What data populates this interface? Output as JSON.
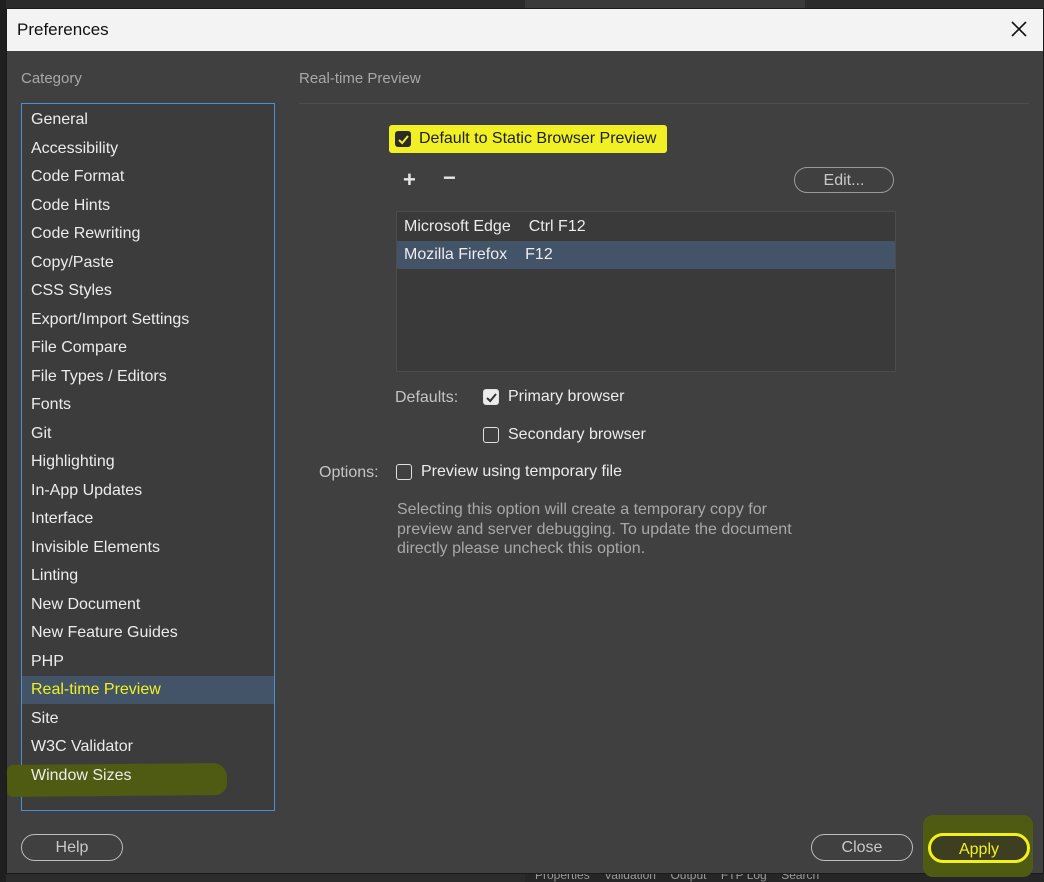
{
  "dialog": {
    "title": "Preferences"
  },
  "category": {
    "label": "Category",
    "items": [
      "General",
      "Accessibility",
      "Code Format",
      "Code Hints",
      "Code Rewriting",
      "Copy/Paste",
      "CSS Styles",
      "Export/Import Settings",
      "File Compare",
      "File Types / Editors",
      "Fonts",
      "Git",
      "Highlighting",
      "In-App Updates",
      "Interface",
      "Invisible Elements",
      "Linting",
      "New Document",
      "New Feature Guides",
      "PHP",
      "Real-time Preview",
      "Site",
      "W3C Validator",
      "Window Sizes"
    ],
    "selected": "Real-time Preview"
  },
  "panel": {
    "section_title": "Real-time Preview",
    "static_preview": {
      "label": "Default to Static Browser Preview",
      "checked": true
    },
    "add_icon": "plus-icon",
    "remove_icon": "minus-icon",
    "edit_label": "Edit...",
    "browsers": [
      {
        "name": "Microsoft Edge",
        "shortcut": "Ctrl F12"
      },
      {
        "name": "Mozilla Firefox",
        "shortcut": "F12",
        "selected": true
      }
    ],
    "defaults_label": "Defaults:",
    "primary_browser": {
      "label": "Primary browser",
      "checked": true
    },
    "secondary_browser": {
      "label": "Secondary browser",
      "checked": false
    },
    "options_label": "Options:",
    "temp_file": {
      "label": "Preview using temporary file",
      "checked": false
    },
    "help_text": "Selecting this option will create a temporary copy for preview and server debugging. To update the document directly please uncheck this option."
  },
  "buttons": {
    "help": "Help",
    "close": "Close",
    "apply": "Apply"
  },
  "background": {
    "tabs": [
      "Properties",
      "Validation",
      "Output",
      "FTP Log",
      "Search"
    ]
  },
  "colors": {
    "highlight_yellow": "#f0f024",
    "selection_blue": "#435468",
    "dialog_bg": "#404040"
  }
}
